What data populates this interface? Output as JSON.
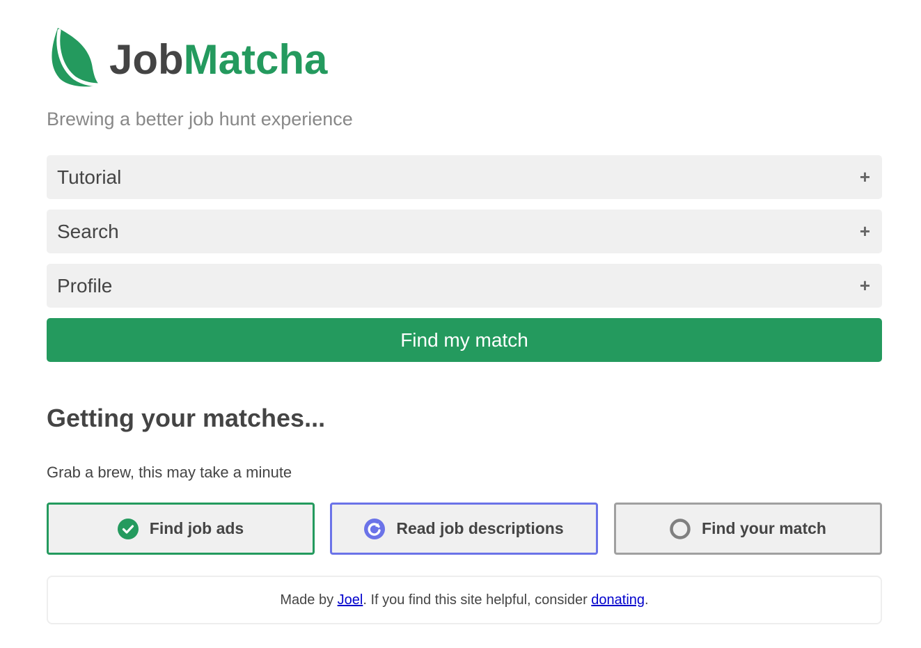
{
  "brand": {
    "part1": "Job",
    "part2": "Matcha",
    "tagline": "Brewing a better job hunt experience"
  },
  "accordion": [
    {
      "label": "Tutorial",
      "icon": "+"
    },
    {
      "label": "Search",
      "icon": "+"
    },
    {
      "label": "Profile",
      "icon": "+"
    }
  ],
  "cta": {
    "label": "Find my match"
  },
  "status": {
    "heading": "Getting your matches...",
    "subtext": "Grab a brew, this may take a minute",
    "steps": [
      {
        "label": "Find job ads",
        "state": "done",
        "icon": "check-circle-icon"
      },
      {
        "label": "Read job descriptions",
        "state": "in-progress",
        "icon": "spinner-icon"
      },
      {
        "label": "Find your match",
        "state": "pending",
        "icon": "empty-circle-icon"
      }
    ]
  },
  "footer": {
    "prefix": "Made by ",
    "author": "Joel",
    "middle": ". If you find this site helpful, consider ",
    "donate": "donating",
    "suffix": "."
  },
  "colors": {
    "brand": "#249a5e",
    "active": "#6b73e8",
    "text": "#444444",
    "muted": "#888888"
  }
}
